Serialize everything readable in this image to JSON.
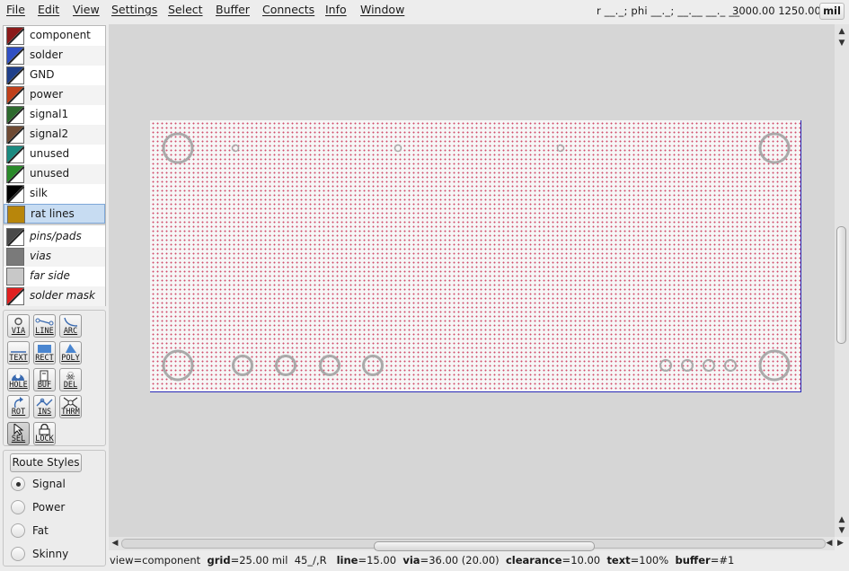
{
  "menu": [
    "File",
    "Edit",
    "View",
    "Settings",
    "Select",
    "Buffer",
    "Connects",
    "Info",
    "Window"
  ],
  "coords": {
    "polar": "r __._; phi __._; __.__ __._ __",
    "xy": "3000.00 1250.00",
    "units": "mil"
  },
  "layers": [
    {
      "label": "component",
      "color": "#8b1a1a",
      "italic": false
    },
    {
      "label": "solder",
      "color": "#2f4fc4",
      "italic": false
    },
    {
      "label": "GND",
      "color": "#1f3f8a",
      "italic": false
    },
    {
      "label": "power",
      "color": "#c0401a",
      "italic": false
    },
    {
      "label": "signal1",
      "color": "#2e6a2e",
      "italic": false
    },
    {
      "label": "signal2",
      "color": "#6e4a33",
      "italic": false
    },
    {
      "label": "unused",
      "color": "#1a8a80",
      "italic": false
    },
    {
      "label": "unused",
      "color": "#2a8a2a",
      "italic": false
    },
    {
      "label": "silk",
      "color": "#000000",
      "italic": false
    },
    {
      "label": "rat lines",
      "color": "#b8860b",
      "italic": false,
      "selected": true
    },
    {
      "label": "pins/pads",
      "color": "#4a4a4a",
      "italic": true
    },
    {
      "label": "vias",
      "color": "#7a7a7a",
      "italic": true
    },
    {
      "label": "far side",
      "color": "#c8c8c8",
      "italic": true
    },
    {
      "label": "solder mask",
      "color": "#e02020",
      "italic": true
    }
  ],
  "tools": [
    {
      "label": "VIA",
      "icon": "via-icon"
    },
    {
      "label": "LINE",
      "icon": "line-icon"
    },
    {
      "label": "ARC",
      "icon": "arc-icon"
    },
    {
      "label": "TEXT",
      "icon": "text-icon"
    },
    {
      "label": "RECT",
      "icon": "rect-icon"
    },
    {
      "label": "POLY",
      "icon": "poly-icon"
    },
    {
      "label": "HOLE",
      "icon": "hole-icon"
    },
    {
      "label": "BUF",
      "icon": "buffer-icon"
    },
    {
      "label": "DEL",
      "icon": "delete-icon"
    },
    {
      "label": "ROT",
      "icon": "rotate-icon"
    },
    {
      "label": "INS",
      "icon": "insert-icon"
    },
    {
      "label": "THRM",
      "icon": "thermal-icon"
    },
    {
      "label": "SEL",
      "icon": "select-icon",
      "active": true
    },
    {
      "label": "LOCK",
      "icon": "lock-icon"
    }
  ],
  "route_styles": {
    "button": "Route Styles",
    "options": [
      {
        "label": "Signal",
        "checked": true
      },
      {
        "label": "Power",
        "checked": false
      },
      {
        "label": "Fat",
        "checked": false
      },
      {
        "label": "Skinny",
        "checked": false
      }
    ]
  },
  "status": {
    "view_key": "view",
    "view_val": "component",
    "grid_key": "grid",
    "grid_val": "25.00 mil",
    "angle": "45_/,R",
    "line_key": "line",
    "line_val": "15.00",
    "via_key": "via",
    "via_val": "36.00 (20.00)",
    "clearance_key": "clearance",
    "clearance_val": "10.00",
    "text_key": "text",
    "text_val": "100%",
    "buffer_key": "buffer",
    "buffer_val": "#1"
  },
  "colors": {
    "board_border": "#2a2ab8",
    "grid_dot": "#d04b6a",
    "pad_stroke": "#a9a9a9",
    "selected_row": "#c7dcf2"
  }
}
